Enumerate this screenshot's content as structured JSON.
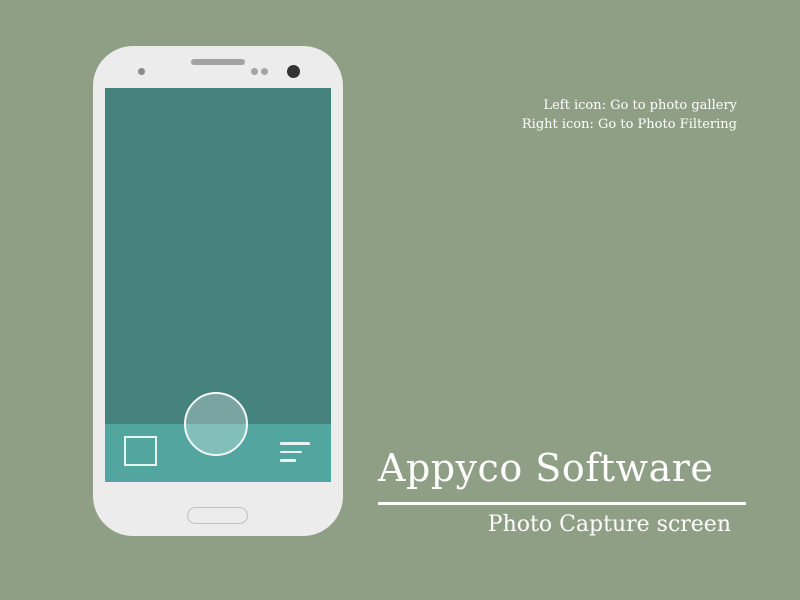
{
  "annotations": {
    "left_icon_note": "Left icon: Go to photo gallery",
    "right_icon_note": "Right icon: Go to Photo Filtering"
  },
  "brand": {
    "title": "Appyco Software",
    "subtitle": "Photo Capture screen"
  },
  "colors": {
    "background": "#8f9f85",
    "phone_body": "#ececec",
    "screen": "#46827d",
    "bottom_bar": "#53a6a0"
  },
  "phone": {
    "icons": {
      "left": "gallery-icon",
      "center": "capture-button",
      "right": "filter-icon"
    }
  }
}
